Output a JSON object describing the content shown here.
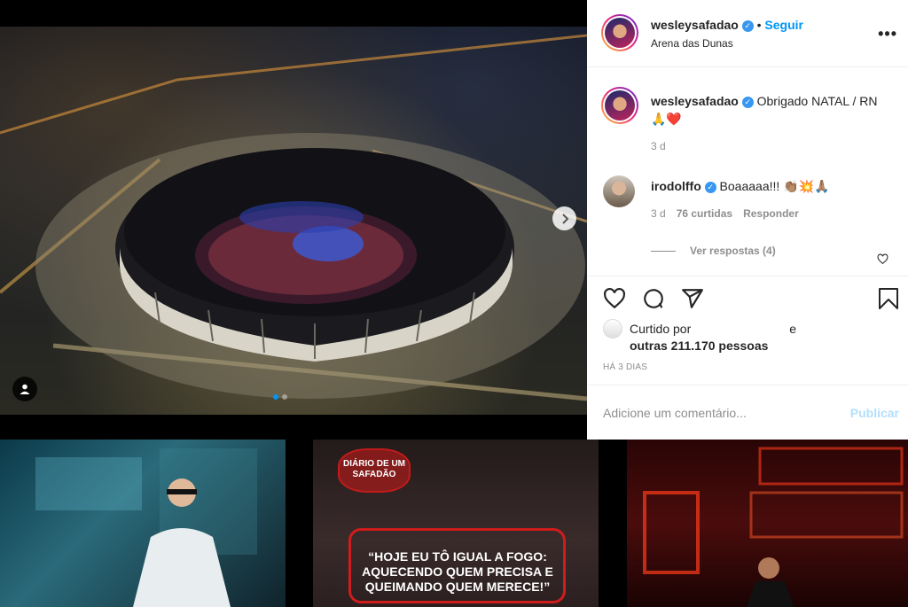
{
  "post": {
    "username": "wesleysafadao",
    "follow_label": "Seguir",
    "location": "Arena das Dunas",
    "caption": "Obrigado NATAL / RN 🙏❤️",
    "caption_time": "3 d"
  },
  "comments": [
    {
      "username": "irodolffo",
      "text": "Boaaaaa!!! 👏🏽💥🙏🏽",
      "time": "3 d",
      "likes": "76 curtidas",
      "reply_label": "Responder",
      "view_replies": "Ver respostas (4)"
    }
  ],
  "likes": {
    "prefix": "Curtido por",
    "suffix": "e",
    "others": "outras 211.170 pessoas"
  },
  "posted_ago": "HÁ 3 DIAS",
  "add_comment": {
    "placeholder": "Adicione um comentário...",
    "publish_label": "Publicar"
  },
  "thumbnails": {
    "middle_badge": "DIÁRIO DE UM SAFADÃO",
    "middle_quote": "“HOJE EU TÔ IGUAL A FOGO: AQUECENDO QUEM PRECISA E QUEIMANDO QUEM MERECE!”"
  },
  "colors": {
    "link_blue": "#0095f6",
    "publish_disabled": "#b2dffc",
    "verified_blue": "#3897f0"
  },
  "icons": [
    "heart-icon",
    "comment-icon",
    "share-icon",
    "bookmark-icon",
    "more-icon",
    "chevron-right-icon",
    "user-tag-icon"
  ]
}
